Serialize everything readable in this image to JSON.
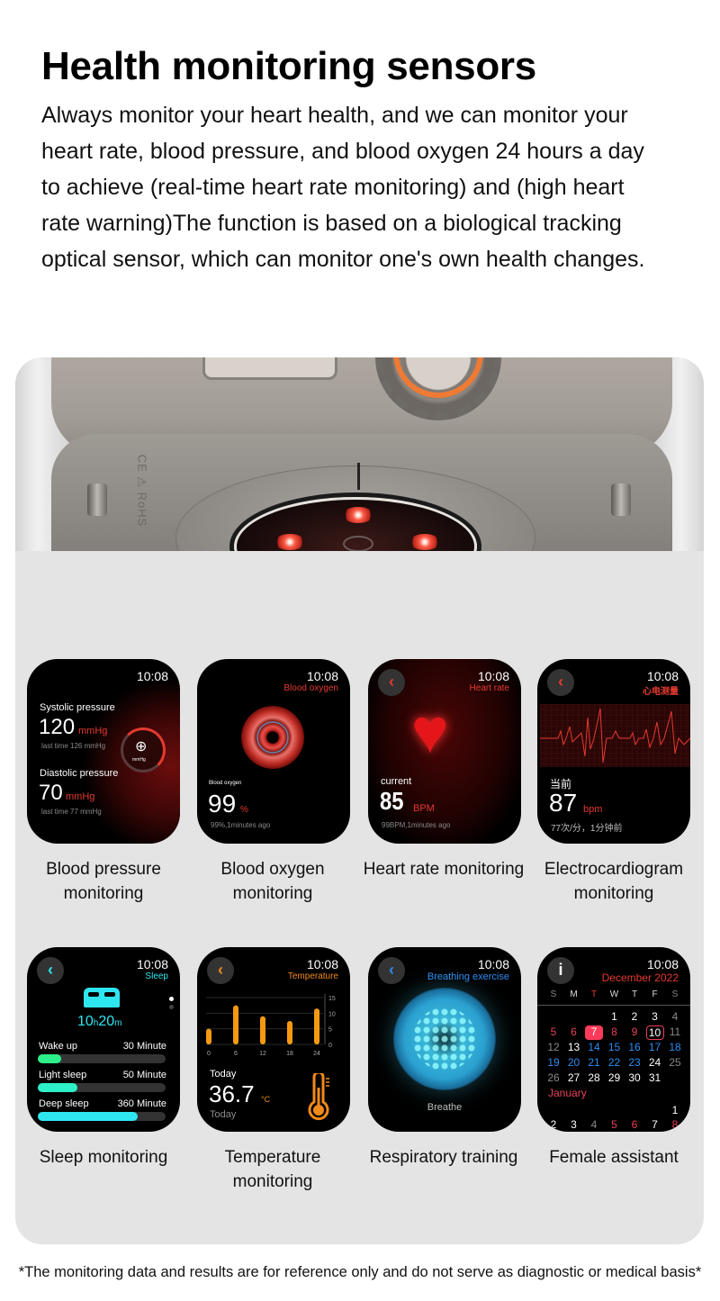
{
  "header": {
    "title": "Health monitoring sensors",
    "description": "Always monitor your heart health, and we can monitor your heart rate, blood pressure, and blood oxygen 24 hours a day to achieve (real-time heart rate monitoring) and (high heart rate warning)The function is based on a biological tracking optical sensor, which can monitor one's own health changes."
  },
  "watch_back": {
    "engraving": "CE ⚠ RoHS",
    "accent_color": "#f07a33"
  },
  "features": [
    {
      "caption": "Blood pressure monitoring",
      "screen": {
        "time": "10:08",
        "systolic_label": "Systolic pressure",
        "systolic_value": "120",
        "unit": "mmHg",
        "systolic_last": "last time 126 mmHg",
        "diastolic_label": "Diastolic pressure",
        "diastolic_value": "70",
        "diastolic_last": "last time 77 mmHg",
        "gauge_unit": "mmHg"
      }
    },
    {
      "caption": "Blood oxygen monitoring",
      "screen": {
        "time": "10:08",
        "title": "Blood oxygen",
        "label": "Blood oxygen",
        "value": "99",
        "unit": "%",
        "last": "99%,1minutes ago"
      }
    },
    {
      "caption": "Heart rate monitoring",
      "screen": {
        "time": "10:08",
        "title": "Heart rate",
        "label": "current",
        "value": "85",
        "unit": "BPM",
        "last": "99BPM,1minutes ago"
      }
    },
    {
      "caption": "Electrocardiogram monitoring",
      "screen": {
        "time": "10:08",
        "title": "心电测量",
        "label": "当前",
        "value": "87",
        "unit": "bpm",
        "last": "77次/分，1分钟前"
      }
    },
    {
      "caption": "Sleep monitoring",
      "screen": {
        "time": "10:08",
        "title": "Sleep",
        "total_hours": "10",
        "hours_unit": "h",
        "total_minutes": "20",
        "minutes_unit": "m",
        "stages": [
          {
            "label": "Wake up",
            "value": "30 Minute",
            "fraction": 0.18,
            "color": "#2ef08a"
          },
          {
            "label": "Light sleep",
            "value": "50 Minute",
            "fraction": 0.31,
            "color": "#2ef0c8"
          },
          {
            "label": "Deep sleep",
            "value": "360 Minute",
            "fraction": 0.78,
            "color": "#2ee6f0"
          }
        ]
      }
    },
    {
      "caption": "Temperature monitoring",
      "screen": {
        "time": "10:08",
        "title": "Temperature",
        "chart_data": {
          "type": "bar",
          "categories": [
            "0",
            "6",
            "12",
            "18",
            "24"
          ],
          "values": [
            5,
            12.5,
            9,
            7.5,
            11.5
          ],
          "ylim": [
            0,
            15
          ],
          "yticks": [
            "15",
            "10",
            "5",
            "0"
          ]
        },
        "today_label": "Today",
        "value": "36.7",
        "unit": "°C",
        "sub_label": "Today"
      }
    },
    {
      "caption": "Respiratory training",
      "screen": {
        "time": "10:08",
        "title": "Breathing exercise",
        "action": "Breathe"
      }
    },
    {
      "caption": "Female assistant",
      "screen": {
        "time": "10:08",
        "title": "December 2022",
        "weekdays": [
          "S",
          "M",
          "T",
          "W",
          "T",
          "F",
          "S"
        ],
        "weeks": [
          [
            "",
            "",
            "",
            "1",
            "2",
            "3",
            "4"
          ],
          [
            "5",
            "6",
            "7",
            "8",
            "9",
            "10",
            "11"
          ],
          [
            "12",
            "13",
            "14",
            "15",
            "16",
            "17",
            "18"
          ],
          [
            "19",
            "20",
            "21",
            "22",
            "23",
            "24",
            "25"
          ],
          [
            "26",
            "27",
            "28",
            "29",
            "30",
            "31",
            ""
          ]
        ],
        "next_month": "January",
        "next_weeks": [
          [
            "",
            "",
            "",
            "",
            "",
            "",
            "1"
          ],
          [
            "2",
            "3",
            "4",
            "5",
            "6",
            "7",
            "8"
          ]
        ]
      }
    }
  ],
  "footer": {
    "disclaimer": "*The monitoring data and results are for reference only and do not serve as diagnostic or medical basis*"
  }
}
